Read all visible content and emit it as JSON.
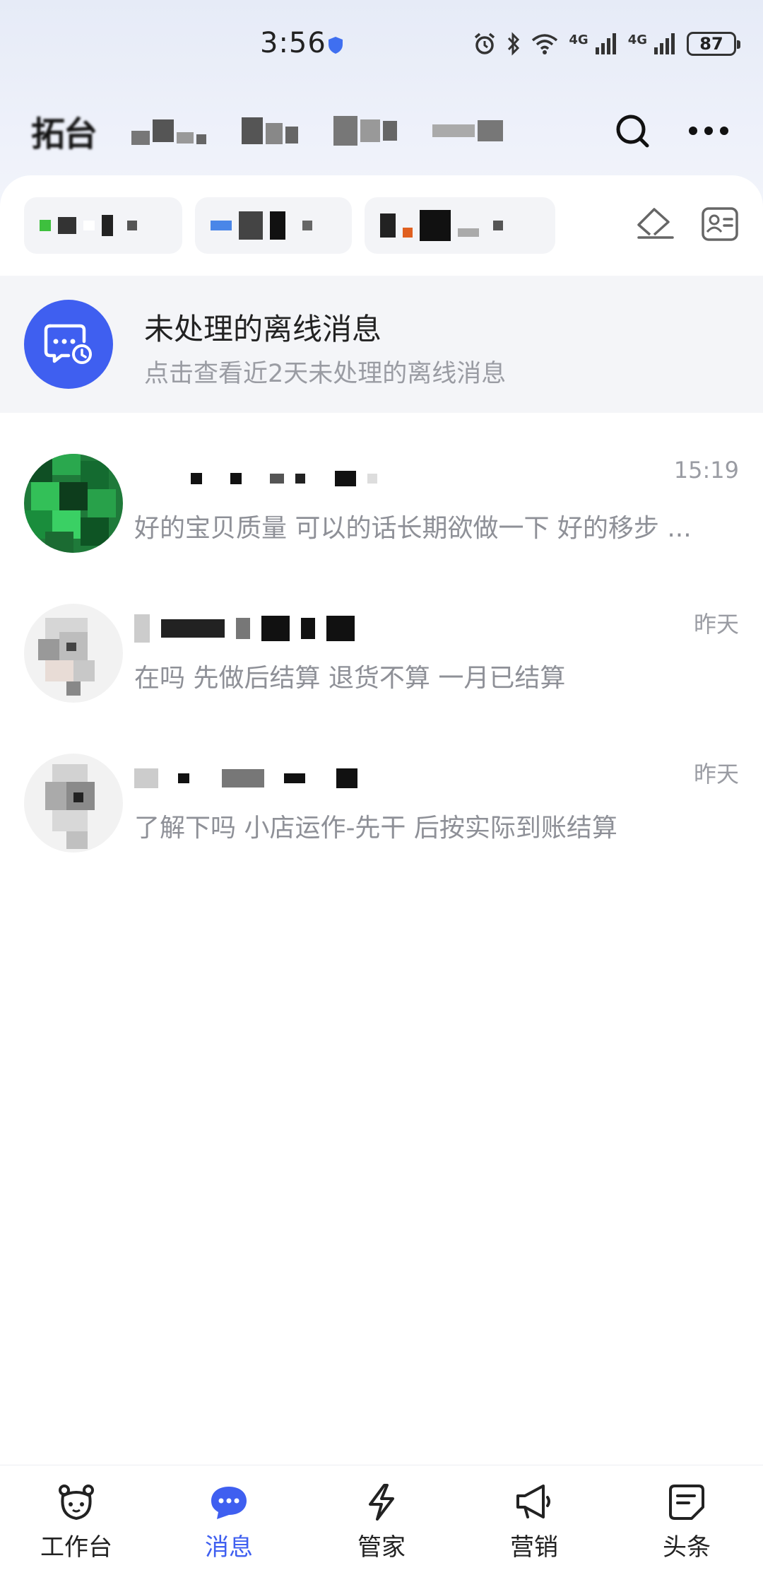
{
  "status_bar": {
    "time": "3:56",
    "network_1": "4G",
    "network_2": "4G",
    "battery": "87"
  },
  "header": {
    "shop_name": "拓台",
    "search_icon": "search-icon",
    "more_icon": "more-icon"
  },
  "filters": {
    "clear_icon": "eraser-icon",
    "contacts_icon": "contact-card-icon"
  },
  "offline_banner": {
    "title": "未处理的离线消息",
    "subtitle": "点击查看近2天未处理的离线消息",
    "icon": "offline-chat-clock-icon",
    "accent": "#3f5ff0"
  },
  "conversations": [
    {
      "time": "15:19",
      "message": "好的宝贝质量  可以的话长期欲做一下 好的移步 ..."
    },
    {
      "time": "昨天",
      "message": "在吗 先做后结算 退货不算 一月已结算"
    },
    {
      "time": "昨天",
      "message": "了解下吗 小店运作-先干 后按实际到账结算"
    }
  ],
  "bottom_nav": {
    "items": [
      {
        "label": "工作台",
        "icon": "bear-face-icon"
      },
      {
        "label": "消息",
        "icon": "chat-bubble-icon",
        "active": true
      },
      {
        "label": "管家",
        "icon": "lightning-icon"
      },
      {
        "label": "营销",
        "icon": "megaphone-icon"
      },
      {
        "label": "头条",
        "icon": "news-icon"
      }
    ],
    "active_color": "#3f5ff0"
  }
}
